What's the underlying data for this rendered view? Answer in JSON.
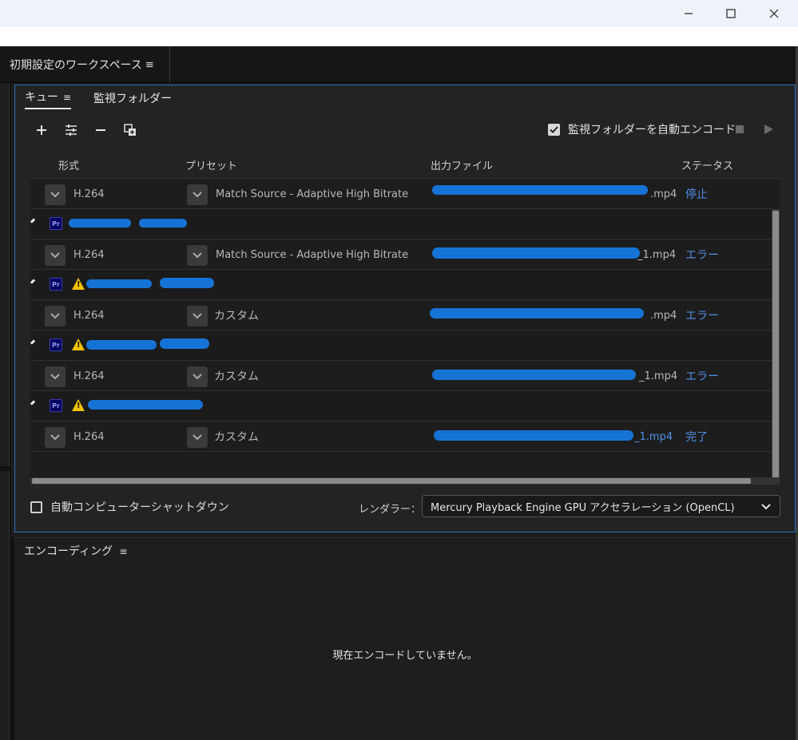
{
  "window": {
    "minimize_icon": "minimize-icon",
    "maximize_icon": "maximize-icon",
    "close_icon": "close-icon"
  },
  "workspace": {
    "tab_label": "初期設定のワークスペース",
    "menu_icon": "≡"
  },
  "queue_panel": {
    "tabs": [
      {
        "label": "キュー",
        "menu": "≡"
      },
      {
        "label": "監視フォルダー"
      }
    ],
    "toolbar": {
      "add": "+",
      "settings": "settings-icon",
      "remove": "−",
      "duplicate": "duplicate-icon"
    },
    "auto_encode_label": "監視フォルダーを自動エンコード",
    "auto_encode_checked": true,
    "columns": {
      "format": "形式",
      "preset": "プリセット",
      "output": "出力ファイル",
      "status": "ステータス"
    },
    "groups": [
      {
        "warning": false,
        "item": {
          "format": "H.264",
          "preset": "Match Source - Adaptive High Bitrate",
          "output_suffix": ".mp4",
          "status": "停止"
        }
      },
      {
        "warning": false,
        "item": {
          "format": "H.264",
          "preset": "Match Source - Adaptive High Bitrate",
          "output_suffix": "_1.mp4",
          "status": "エラー"
        }
      },
      {
        "warning": true,
        "item": {
          "format": "H.264",
          "preset": "カスタム",
          "output_suffix": ".mp4",
          "status": "エラー"
        }
      },
      {
        "warning": true,
        "item": {
          "format": "H.264",
          "preset": "カスタム",
          "output_suffix": "_1.mp4",
          "status": "エラー"
        }
      },
      {
        "warning": true,
        "item": {
          "format": "H.264",
          "preset": "カスタム",
          "output_suffix": "_1.mp4",
          "status": "完了"
        }
      }
    ],
    "pr_badge": "Pr",
    "shutdown_label": "自動コンピューターシャットダウン",
    "renderer_label": "レンダラー：",
    "renderer_value": "Mercury Playback Engine GPU アクセラレーション (OpenCL)"
  },
  "encoding_panel": {
    "title": "エンコーディング",
    "menu_icon": "≡",
    "message": "現在エンコードしていません。"
  },
  "colors": {
    "accent_border": "#2a6ebf",
    "status_link": "#4f8fe6",
    "redaction": "#1673d6",
    "warning": "#f2c200"
  }
}
